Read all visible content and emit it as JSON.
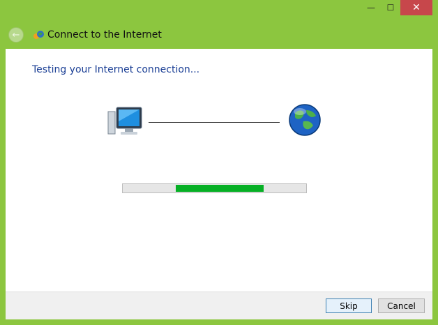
{
  "window": {
    "title": "Connect to the Internet",
    "controls": {
      "minimize": "—",
      "maximize": "☐",
      "close": "✕"
    }
  },
  "nav": {
    "back_icon": "back-arrow-icon",
    "title": "Connect to the Internet"
  },
  "main": {
    "heading": "Testing your Internet connection...",
    "progress": {
      "start": 0.29,
      "end": 0.77
    }
  },
  "footer": {
    "skip_label": "Skip",
    "cancel_label": "Cancel"
  },
  "colors": {
    "window_frame": "#8cc63f",
    "heading": "#1b3f95",
    "progress_fill": "#06b025"
  }
}
